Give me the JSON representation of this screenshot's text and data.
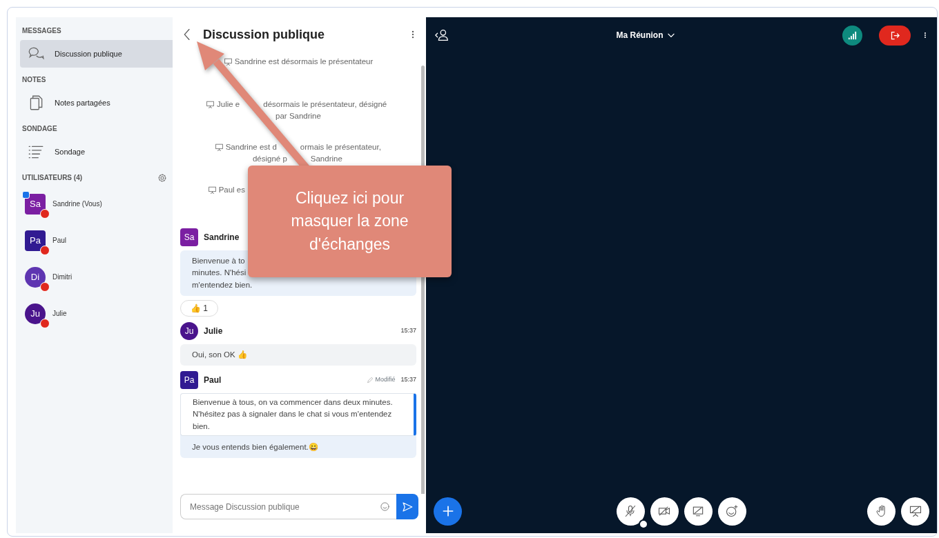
{
  "sidebar": {
    "sections": [
      {
        "heading": "MESSAGES",
        "items": [
          {
            "label": "Discussion publique",
            "selected": true
          }
        ]
      },
      {
        "heading": "NOTES",
        "items": [
          {
            "label": "Notes partagées",
            "selected": false
          }
        ]
      },
      {
        "heading": "SONDAGE",
        "items": [
          {
            "label": "Sondage",
            "selected": false
          }
        ]
      }
    ],
    "users_heading": "UTILISATEURS (4)",
    "users": [
      {
        "initials": "Sa",
        "name": "Sandrine (Vous)",
        "color": "#7b1fa2",
        "kind": "moderator",
        "presenter": true
      },
      {
        "initials": "Pa",
        "name": "Paul",
        "color": "#311b92",
        "kind": "moderator",
        "presenter": false
      },
      {
        "initials": "Di",
        "name": "Dimitri",
        "color": "#5e35b1",
        "kind": "viewer",
        "presenter": false
      },
      {
        "initials": "Ju",
        "name": "Julie",
        "color": "#4a148c",
        "kind": "viewer",
        "presenter": false
      }
    ]
  },
  "chat": {
    "title": "Discussion publique",
    "input": {
      "placeholder": "Message Discussion publique"
    },
    "items": [
      {
        "kind": "system",
        "lines": [
          [
            "Sandrine est désormais le présentateur"
          ]
        ]
      },
      {
        "kind": "system",
        "lines": [
          [
            "Julie e",
            "désormais le présentateur, désigné"
          ],
          [
            "par Sandrine"
          ]
        ]
      },
      {
        "kind": "system",
        "lines": [
          [
            "Sandrine est d",
            "ormais le présentateur,"
          ],
          [
            "désigné p",
            "Sandrine"
          ]
        ]
      },
      {
        "kind": "system",
        "lines": [
          [
            "Paul es"
          ]
        ]
      },
      {
        "kind": "moderator",
        "initials": "Sa",
        "name": "Sandrine",
        "color": "#7b1fa2",
        "lines": [
          "Bienvenue à to",
          "minutes. N'hési",
          "m'entendez bien."
        ],
        "reaction": {
          "emoji": "👍",
          "count": "1"
        }
      },
      {
        "kind": "viewer",
        "initials": "Ju",
        "name": "Julie",
        "color": "#4a148c",
        "time": "15:37",
        "text": "Oui, son OK 👍"
      },
      {
        "kind": "moderator",
        "initials": "Pa",
        "name": "Paul",
        "color": "#311b92",
        "edited": "Modifié",
        "time": "15:37",
        "quote": "Bienvenue à tous, on va commencer dans deux minutes. N'hésitez pas à signaler dans le chat si vous m'entendez bien.",
        "text": "Je vous entends bien également.😀"
      }
    ]
  },
  "meeting": {
    "title": "Ma Réunion"
  },
  "callout": {
    "text": "Cliquez ici pour masquer la zone d'échanges"
  }
}
